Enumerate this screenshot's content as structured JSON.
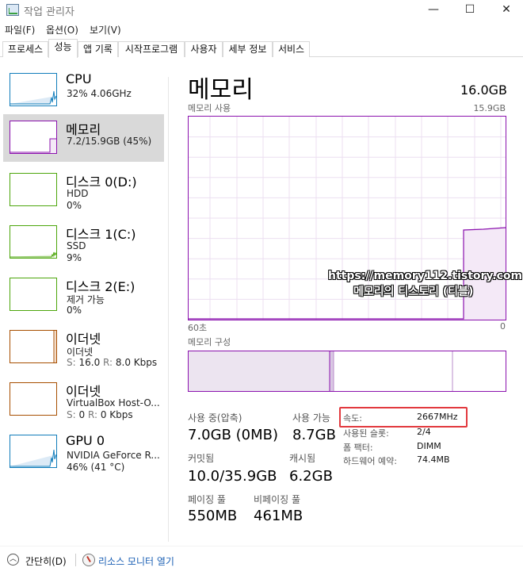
{
  "window": {
    "title": "작업 관리자",
    "controls": {
      "minimize": "—",
      "maximize": "☐",
      "close": "✕"
    }
  },
  "menu": [
    "파일(F)",
    "옵션(O)",
    "보기(V)"
  ],
  "tabs": [
    "프로세스",
    "성능",
    "앱 기록",
    "시작프로그램",
    "사용자",
    "세부 정보",
    "서비스"
  ],
  "active_tab": "성능",
  "sidebar": [
    {
      "name": "CPU",
      "line2": "32%  4.06GHz",
      "line3": ""
    },
    {
      "name": "메모리",
      "line2": "7.2/15.9GB (45%)",
      "line3": ""
    },
    {
      "name": "디스크 0(D:)",
      "line2": "HDD",
      "line3": "0%"
    },
    {
      "name": "디스크 1(C:)",
      "line2": "SSD",
      "line3": "9%"
    },
    {
      "name": "디스크 2(E:)",
      "line2": "제거 가능",
      "line3": "0%"
    },
    {
      "name": "이더넷",
      "line2": "이더넷",
      "line3_s": "S:",
      "line3_sv": "16.0",
      "line3_r": "R:",
      "line3_rv": "8.0 Kbps"
    },
    {
      "name": "이더넷",
      "line2": "VirtualBox Host-O...",
      "line3_s": "S:",
      "line3_sv": "0",
      "line3_r": "R:",
      "line3_rv": "0 Kbps"
    },
    {
      "name": "GPU 0",
      "line2": "NVIDIA GeForce R...",
      "line3": "46% (41 °C)"
    }
  ],
  "colors": {
    "cpu": "#117dbb",
    "memory": "#8b12ae",
    "disk": "#4da60c",
    "ethernet": "#a74f01",
    "highlight": "#e2393e",
    "link": "#1a5fb4"
  },
  "main": {
    "title": "메모리",
    "total": "16.0GB",
    "usage_label": "메모리 사용",
    "usage_max": "15.9GB",
    "axis_left": "60초",
    "axis_right": "0",
    "composition_label": "메모리 구성"
  },
  "watermark": {
    "line1": "https://memory112.tistory.com",
    "line2": "메모리의 티스토리 (티블)"
  },
  "stats": {
    "in_use_label": "사용 중(압축)",
    "in_use_value": "7.0GB (0MB)",
    "available_label": "사용 가능",
    "available_value": "8.7GB",
    "committed_label": "커밋됨",
    "committed_value": "10.0/35.9GB",
    "cached_label": "캐시됨",
    "cached_value": "6.2GB",
    "paged_label": "페이징 풀",
    "paged_value": "550MB",
    "nonpaged_label": "비페이징 풀",
    "nonpaged_value": "461MB"
  },
  "details": [
    {
      "key": "속도:",
      "value": "2667MHz"
    },
    {
      "key": "사용된 슬롯:",
      "value": "2/4"
    },
    {
      "key": "폼 팩터:",
      "value": "DIMM"
    },
    {
      "key": "하드웨어 예약:",
      "value": "74.4MB"
    }
  ],
  "footer": {
    "fewer_details": "간단히(D)",
    "resource_monitor": "리소스 모니터 열기"
  }
}
